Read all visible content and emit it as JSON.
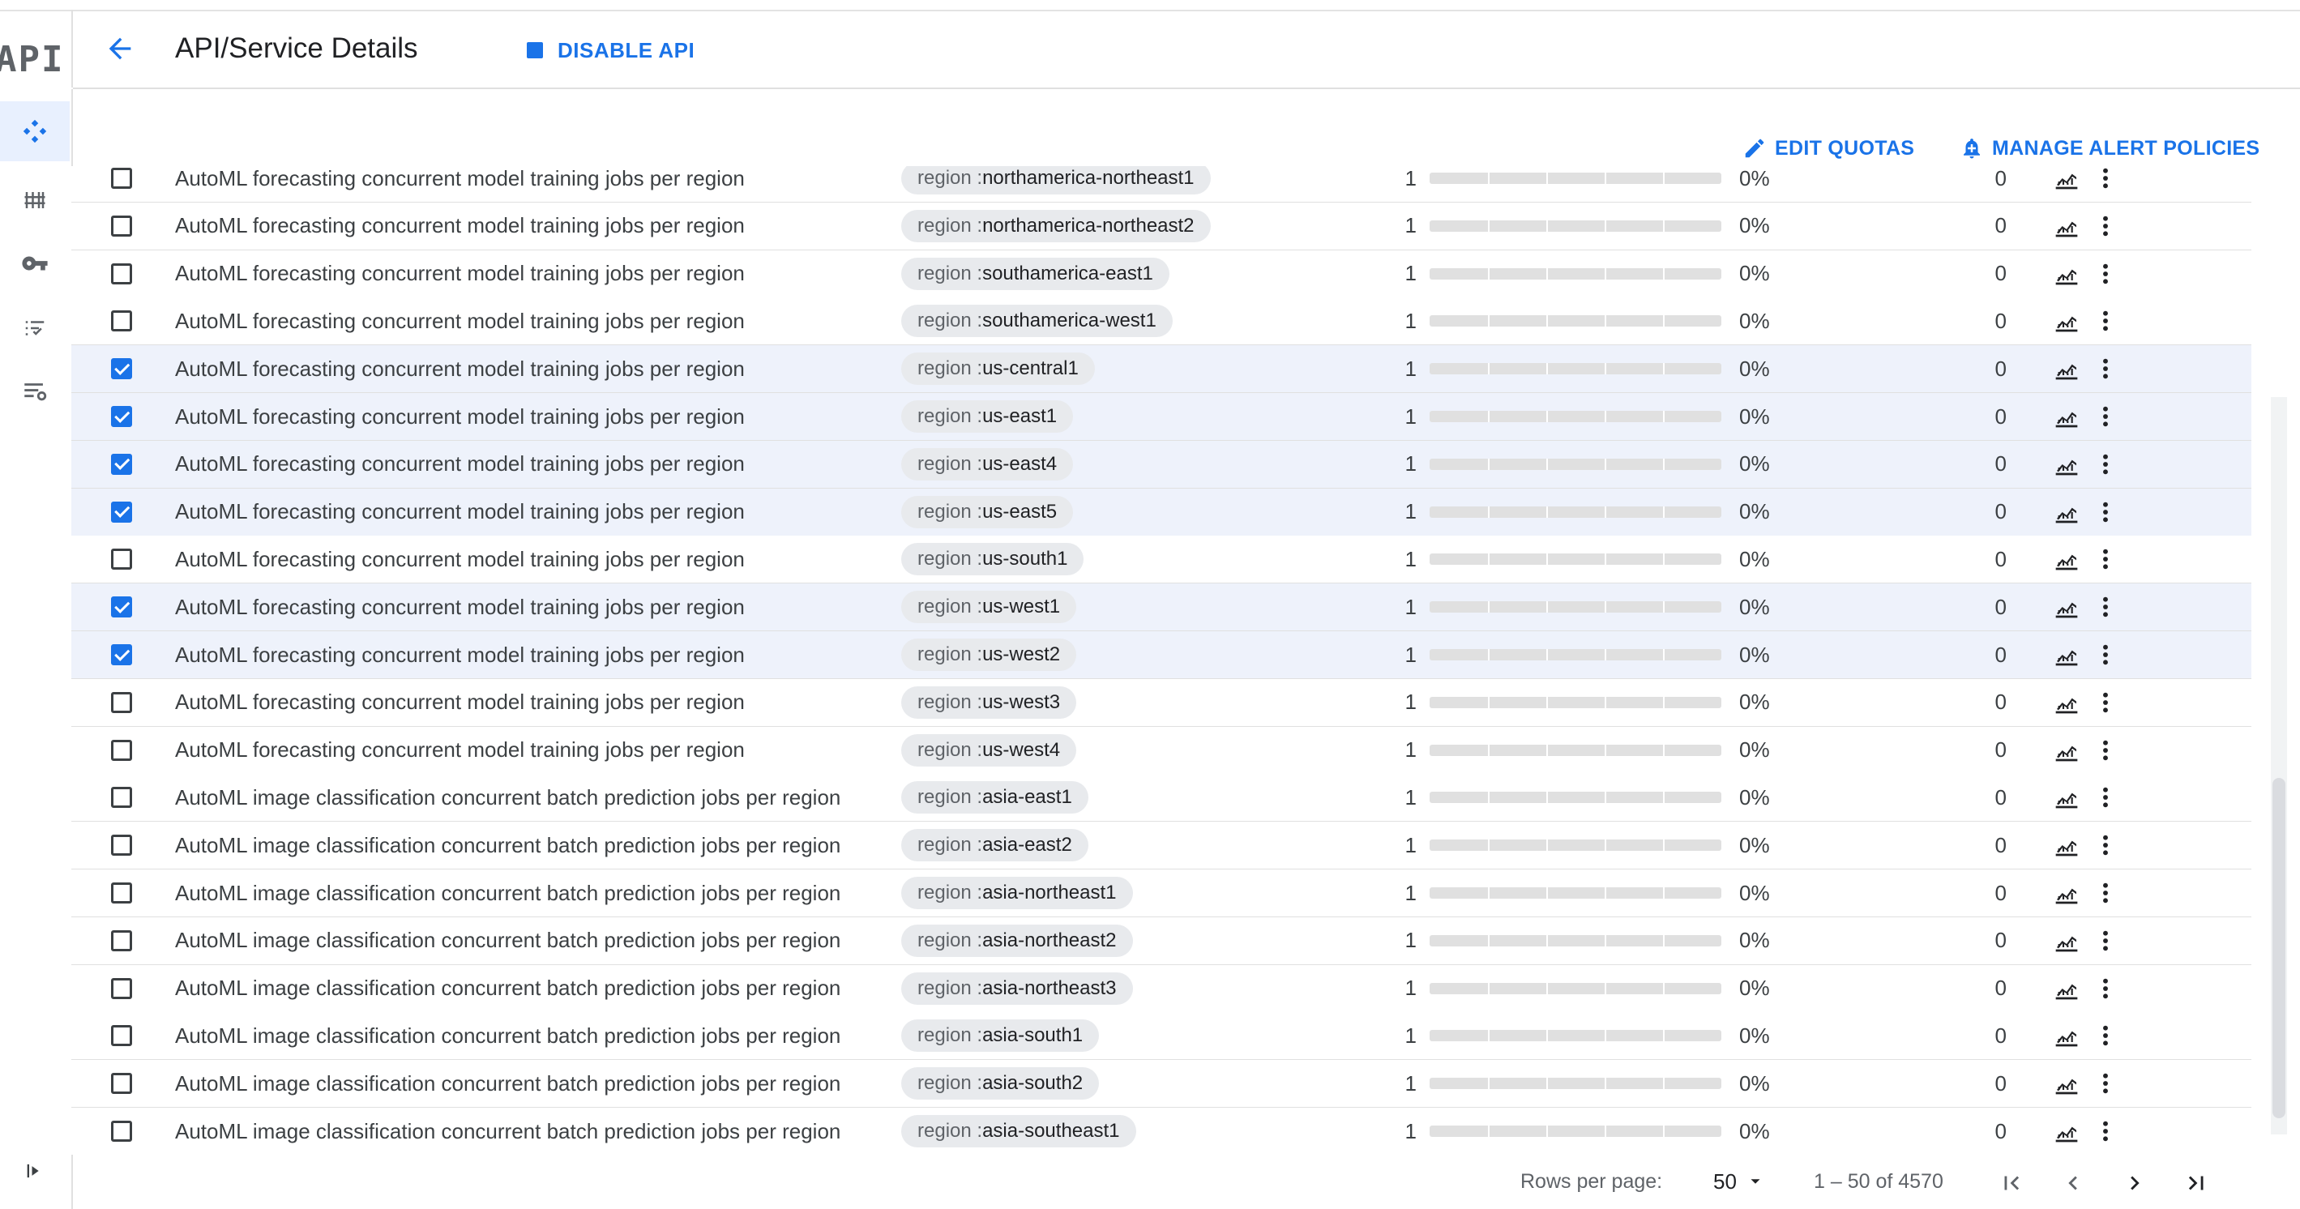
{
  "app": {
    "logo_text": "API"
  },
  "header": {
    "title": "API/Service Details",
    "disable_label": "DISABLE API"
  },
  "actions": {
    "edit_quotas": "EDIT QUOTAS",
    "manage_alerts": "MANAGE ALERT POLICIES"
  },
  "rail": {
    "icons": [
      "api-explorer-icon",
      "dashboard-bars-icon",
      "key-icon",
      "checklist-icon",
      "settings-list-icon"
    ],
    "expand_icon": "expand-panel-icon"
  },
  "table": {
    "chip_key": "region : ",
    "rows": [
      {
        "checked": false,
        "name": "AutoML forecasting concurrent model training jobs per region",
        "region": "northamerica-northeast1",
        "limit": "1",
        "usage_fraction": 0,
        "usage_pct": "0%",
        "usage": "0"
      },
      {
        "checked": false,
        "name": "AutoML forecasting concurrent model training jobs per region",
        "region": "northamerica-northeast2",
        "limit": "1",
        "usage_fraction": 0,
        "usage_pct": "0%",
        "usage": "0"
      },
      {
        "checked": false,
        "name": "AutoML forecasting concurrent model training jobs per region",
        "region": "southamerica-east1",
        "limit": "1",
        "usage_fraction": 0,
        "usage_pct": "0%",
        "usage": "0"
      },
      {
        "checked": false,
        "name": "AutoML forecasting concurrent model training jobs per region",
        "region": "southamerica-west1",
        "limit": "1",
        "usage_fraction": 0,
        "usage_pct": "0%",
        "usage": "0"
      },
      {
        "checked": true,
        "name": "AutoML forecasting concurrent model training jobs per region",
        "region": "us-central1",
        "limit": "1",
        "usage_fraction": 0,
        "usage_pct": "0%",
        "usage": "0"
      },
      {
        "checked": true,
        "name": "AutoML forecasting concurrent model training jobs per region",
        "region": "us-east1",
        "limit": "1",
        "usage_fraction": 0,
        "usage_pct": "0%",
        "usage": "0"
      },
      {
        "checked": true,
        "name": "AutoML forecasting concurrent model training jobs per region",
        "region": "us-east4",
        "limit": "1",
        "usage_fraction": 0,
        "usage_pct": "0%",
        "usage": "0"
      },
      {
        "checked": true,
        "name": "AutoML forecasting concurrent model training jobs per region",
        "region": "us-east5",
        "limit": "1",
        "usage_fraction": 0,
        "usage_pct": "0%",
        "usage": "0"
      },
      {
        "checked": false,
        "name": "AutoML forecasting concurrent model training jobs per region",
        "region": "us-south1",
        "limit": "1",
        "usage_fraction": 0,
        "usage_pct": "0%",
        "usage": "0"
      },
      {
        "checked": true,
        "name": "AutoML forecasting concurrent model training jobs per region",
        "region": "us-west1",
        "limit": "1",
        "usage_fraction": 0,
        "usage_pct": "0%",
        "usage": "0"
      },
      {
        "checked": true,
        "name": "AutoML forecasting concurrent model training jobs per region",
        "region": "us-west2",
        "limit": "1",
        "usage_fraction": 0,
        "usage_pct": "0%",
        "usage": "0"
      },
      {
        "checked": false,
        "name": "AutoML forecasting concurrent model training jobs per region",
        "region": "us-west3",
        "limit": "1",
        "usage_fraction": 0,
        "usage_pct": "0%",
        "usage": "0"
      },
      {
        "checked": false,
        "name": "AutoML forecasting concurrent model training jobs per region",
        "region": "us-west4",
        "limit": "1",
        "usage_fraction": 0,
        "usage_pct": "0%",
        "usage": "0"
      },
      {
        "checked": false,
        "name": "AutoML image classification concurrent batch prediction jobs per region",
        "region": "asia-east1",
        "limit": "1",
        "usage_fraction": 0,
        "usage_pct": "0%",
        "usage": "0"
      },
      {
        "checked": false,
        "name": "AutoML image classification concurrent batch prediction jobs per region",
        "region": "asia-east2",
        "limit": "1",
        "usage_fraction": 0,
        "usage_pct": "0%",
        "usage": "0"
      },
      {
        "checked": false,
        "name": "AutoML image classification concurrent batch prediction jobs per region",
        "region": "asia-northeast1",
        "limit": "1",
        "usage_fraction": 0,
        "usage_pct": "0%",
        "usage": "0"
      },
      {
        "checked": false,
        "name": "AutoML image classification concurrent batch prediction jobs per region",
        "region": "asia-northeast2",
        "limit": "1",
        "usage_fraction": 0,
        "usage_pct": "0%",
        "usage": "0"
      },
      {
        "checked": false,
        "name": "AutoML image classification concurrent batch prediction jobs per region",
        "region": "asia-northeast3",
        "limit": "1",
        "usage_fraction": 0,
        "usage_pct": "0%",
        "usage": "0"
      },
      {
        "checked": false,
        "name": "AutoML image classification concurrent batch prediction jobs per region",
        "region": "asia-south1",
        "limit": "1",
        "usage_fraction": 0,
        "usage_pct": "0%",
        "usage": "0"
      },
      {
        "checked": false,
        "name": "AutoML image classification concurrent batch prediction jobs per region",
        "region": "asia-south2",
        "limit": "1",
        "usage_fraction": 0,
        "usage_pct": "0%",
        "usage": "0"
      },
      {
        "checked": false,
        "name": "AutoML image classification concurrent batch prediction jobs per region",
        "region": "asia-southeast1",
        "limit": "1",
        "usage_fraction": 0,
        "usage_pct": "0%",
        "usage": "0"
      }
    ]
  },
  "pagination": {
    "rows_per_page_label": "Rows per page:",
    "rows_per_page_value": "50",
    "range": "1 – 50 of 4570"
  },
  "colors": {
    "accent": "#1a73e8",
    "selected_row": "#eef2fb",
    "chip_bg": "#e8eaed",
    "bar_track": "#e0e0e0"
  }
}
